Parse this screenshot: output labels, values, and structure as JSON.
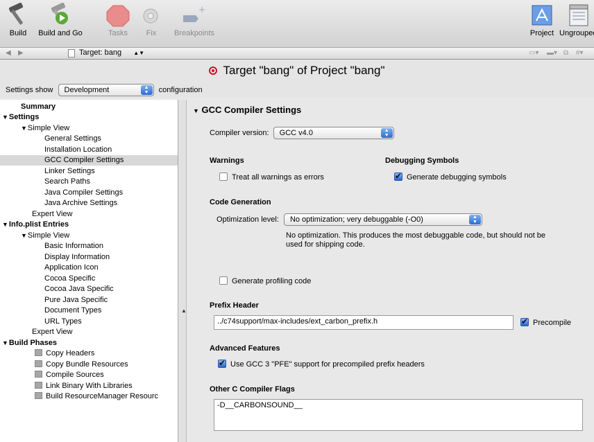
{
  "toolbar": {
    "build": "Build",
    "build_and_go": "Build and Go",
    "tasks": "Tasks",
    "fix": "Fix",
    "breakpoints": "Breakpoints",
    "project": "Project",
    "ungrouped": "Ungrouped"
  },
  "nav": {
    "target": "Target: bang"
  },
  "title": "Target \"bang\" of Project \"bang\"",
  "settings_show": {
    "label": "Settings show",
    "value": "Development",
    "suffix": "configuration"
  },
  "sidebar": {
    "summary": "Summary",
    "settings": "Settings",
    "simple_view": "Simple View",
    "settings_items": [
      "General Settings",
      "Installation Location",
      "GCC Compiler Settings",
      "Linker Settings",
      "Search Paths",
      "Java Compiler Settings",
      "Java Archive Settings"
    ],
    "expert_view": "Expert View",
    "info_plist": "Info.plist Entries",
    "info_items": [
      "Basic Information",
      "Display Information",
      "Application Icon",
      "Cocoa Specific",
      "Cocoa Java Specific",
      "Pure Java Specific",
      "Document Types",
      "URL Types"
    ],
    "build_phases": "Build Phases",
    "phase_items": [
      "Copy Headers",
      "Copy Bundle Resources",
      "Compile Sources",
      "Link Binary With Libraries",
      "Build ResourceManager Resourc"
    ]
  },
  "main": {
    "section_title": "GCC Compiler Settings",
    "compiler_version_label": "Compiler version:",
    "compiler_version": "GCC v4.0",
    "warnings_title": "Warnings",
    "warnings_checkbox": "Treat all warnings as errors",
    "debug_title": "Debugging Symbols",
    "debug_checkbox": "Generate debugging symbols",
    "codegen_title": "Code Generation",
    "opt_label": "Optimization level:",
    "opt_value": "No optimization; very debuggable (-O0)",
    "opt_desc_1": "No optimization.  This produces the most debuggable code, but should not be",
    "opt_desc_2": "used for shipping code.",
    "profiling_checkbox": "Generate profiling code",
    "prefix_title": "Prefix Header",
    "prefix_value": "../c74support/max-includes/ext_carbon_prefix.h",
    "precompile": "Precompile",
    "advanced_title": "Advanced Features",
    "pfe_checkbox": "Use GCC 3 \"PFE\" support for precompiled prefix headers",
    "other_flags_title": "Other C Compiler Flags",
    "other_flags_value": "-D__CARBONSOUND__"
  }
}
